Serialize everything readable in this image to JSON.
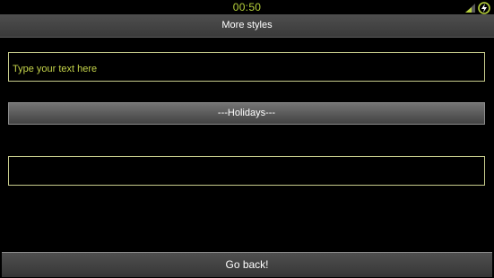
{
  "status_bar": {
    "time": "00:50",
    "signal_icon": "signal-icon",
    "battery_icon": "battery-charging-icon"
  },
  "title_bar": {
    "title": "More styles"
  },
  "input_1": {
    "value": "",
    "placeholder": "Type your text here"
  },
  "spinner": {
    "selected": "---Holidays---"
  },
  "input_2": {
    "value": "",
    "placeholder": ""
  },
  "footer": {
    "go_back_label": "Go back!"
  },
  "colors": {
    "background": "#000000",
    "accent": "#b8d23c",
    "field_border": "#c7cc8c",
    "title_bar": "#444444"
  }
}
